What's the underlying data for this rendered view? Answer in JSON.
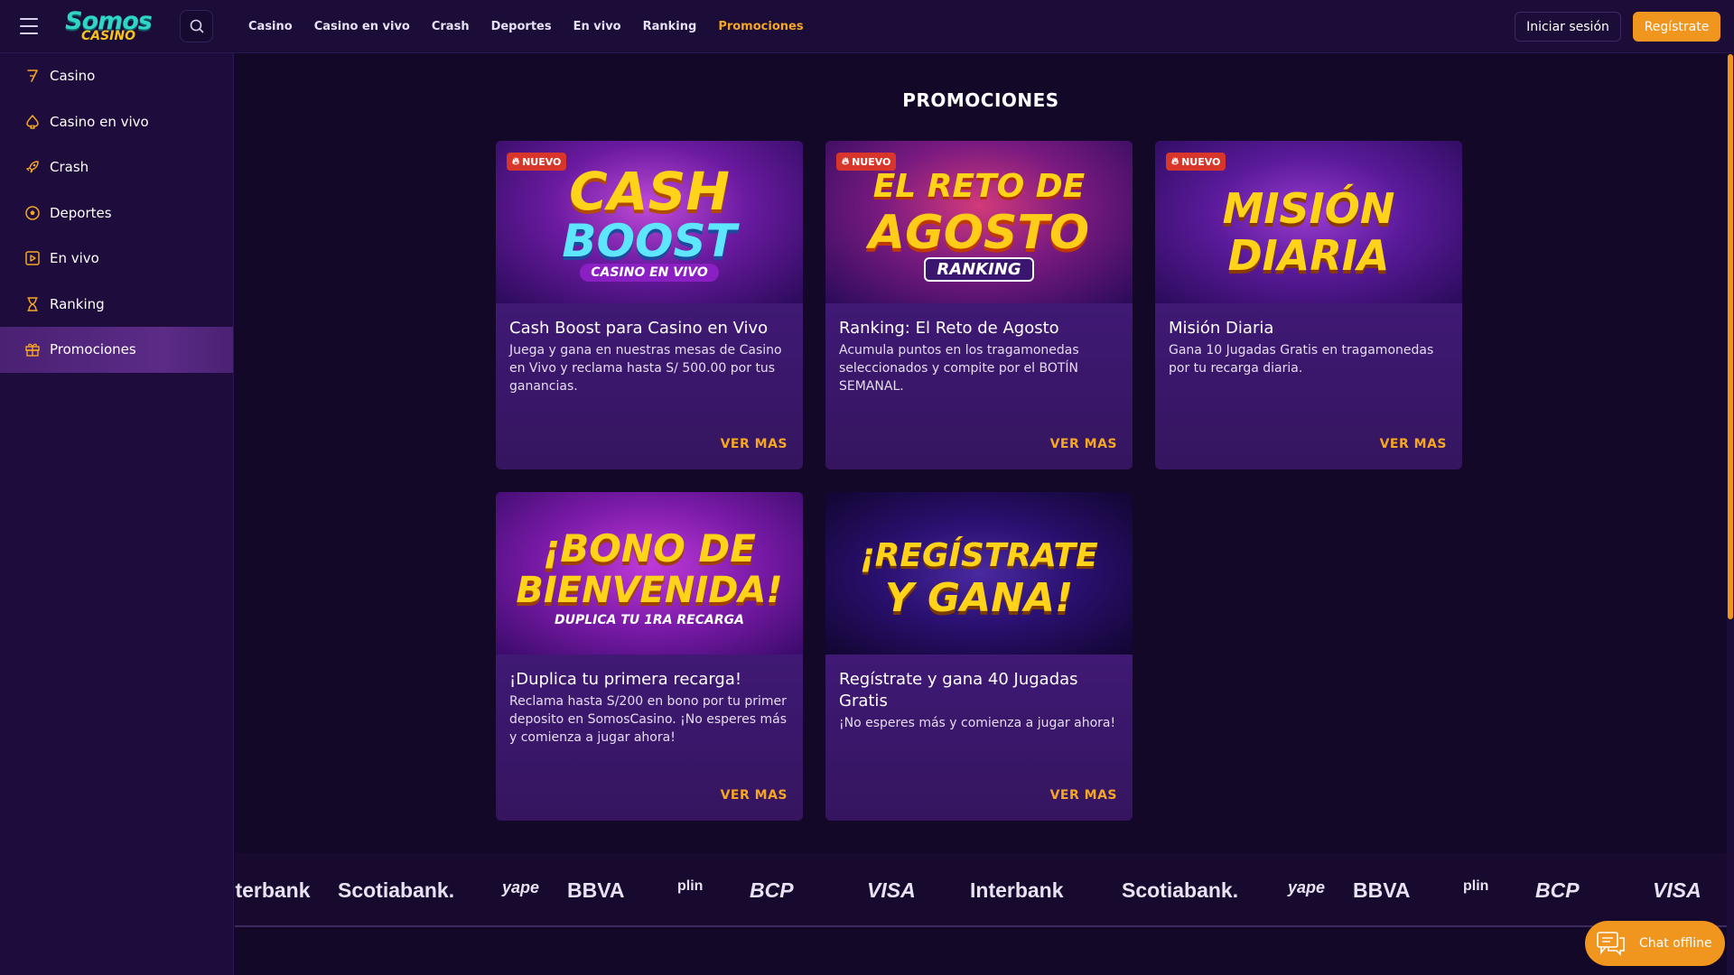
{
  "header": {
    "logo_line1": "Somos",
    "logo_line2": "CASINO",
    "nav": [
      "Casino",
      "Casino en vivo",
      "Crash",
      "Deportes",
      "En vivo",
      "Ranking",
      "Promociones"
    ],
    "active_nav": "Promociones",
    "login_label": "Iniciar sesión",
    "register_label": "Regístrate"
  },
  "sidebar": {
    "items": [
      {
        "label": "Casino",
        "icon": "seven-icon"
      },
      {
        "label": "Casino en vivo",
        "icon": "spade-icon"
      },
      {
        "label": "Crash",
        "icon": "rocket-icon"
      },
      {
        "label": "Deportes",
        "icon": "soccer-ball-icon"
      },
      {
        "label": "En vivo",
        "icon": "play-icon"
      },
      {
        "label": "Ranking",
        "icon": "trophy-icon"
      },
      {
        "label": "Promociones",
        "icon": "gift-icon"
      }
    ],
    "active": "Promociones"
  },
  "main": {
    "title": "PROMOCIONES",
    "cards": [
      {
        "badge": "NUEVO",
        "banner_line1": "CASH",
        "banner_line2": "BOOST",
        "banner_line3": "CASINO EN VIVO",
        "title": "Cash Boost para Casino en Vivo",
        "desc": "Juega y gana en nuestras mesas de Casino en Vivo y reclama hasta S/ 500.00 por tus ganancias.",
        "more": "VER MAS"
      },
      {
        "badge": "NUEVO",
        "banner_line1": "EL RETO DE",
        "banner_line2": "AGOSTO",
        "banner_line3": "RANKING",
        "title": "Ranking: El Reto de Agosto",
        "desc": "Acumula puntos en los tragamonedas seleccionados y compite por el BOTÍN SEMANAL.",
        "more": "VER MAS"
      },
      {
        "badge": "NUEVO",
        "banner_line1": "MISIÓN",
        "banner_line2": "DIARIA",
        "title": "Misión Diaria",
        "desc": "Gana 10 Jugadas Gratis en tragamonedas por tu recarga diaria.",
        "more": "VER MAS"
      },
      {
        "banner_line1": "¡BONO DE",
        "banner_line2": "BIENVENIDA!",
        "banner_line3": "DUPLICA TU 1RA RECARGA",
        "title": "¡Duplica tu primera recarga!",
        "desc": "Reclama hasta S/200 en bono por tu primer deposito en SomosCasino. ¡No esperes más y comienza a jugar ahora!",
        "more": "VER MAS"
      },
      {
        "banner_line1": "¡REGÍSTRATE",
        "banner_line2": "Y GANA!",
        "title": "Regístrate y gana 40 Jugadas Gratis",
        "desc": "¡No esperes más y comienza a jugar ahora!",
        "more": "VER MAS"
      }
    ]
  },
  "partners": [
    "Interbank",
    "Scotiabank.",
    "yape",
    "BBVA",
    "plin",
    "BCP",
    "VISA",
    "Interbank",
    "Scotiabank.",
    "yape",
    "BBVA",
    "plin",
    "BCP",
    "VISA"
  ],
  "chat": {
    "label": "Chat offline"
  },
  "colors": {
    "accent": "#f0951e",
    "active_link": "#f5a623",
    "badge": "#d8362a",
    "sidebar": "#1e0c3d",
    "card": "#4a1e86"
  }
}
